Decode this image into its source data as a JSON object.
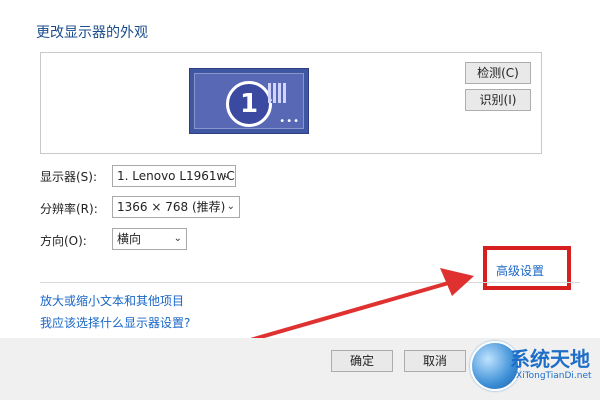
{
  "page": {
    "title": "更改显示器的外观"
  },
  "preview": {
    "display_number": "1",
    "dots": "•••"
  },
  "buttons": {
    "detect": "检测(C)",
    "identify": "识别(I)",
    "ok": "确定",
    "cancel": "取消"
  },
  "settings": {
    "display_label": "显示器(S):",
    "display_value": "1. Lenovo L1961wC",
    "resolution_label": "分辨率(R):",
    "resolution_value": "1366 × 768 (推荐)",
    "orientation_label": "方向(O):",
    "orientation_value": "横向"
  },
  "links": {
    "advanced": "高级设置",
    "enlarge_text": "放大或缩小文本和其他项目",
    "which_settings": "我应该选择什么显示器设置?"
  },
  "watermark": {
    "title": "系统天地",
    "subtitle": "XiTongTianDi.net"
  },
  "colors": {
    "highlight": "#d61f1f",
    "link": "#1866c7",
    "arrow": "#e03131"
  }
}
